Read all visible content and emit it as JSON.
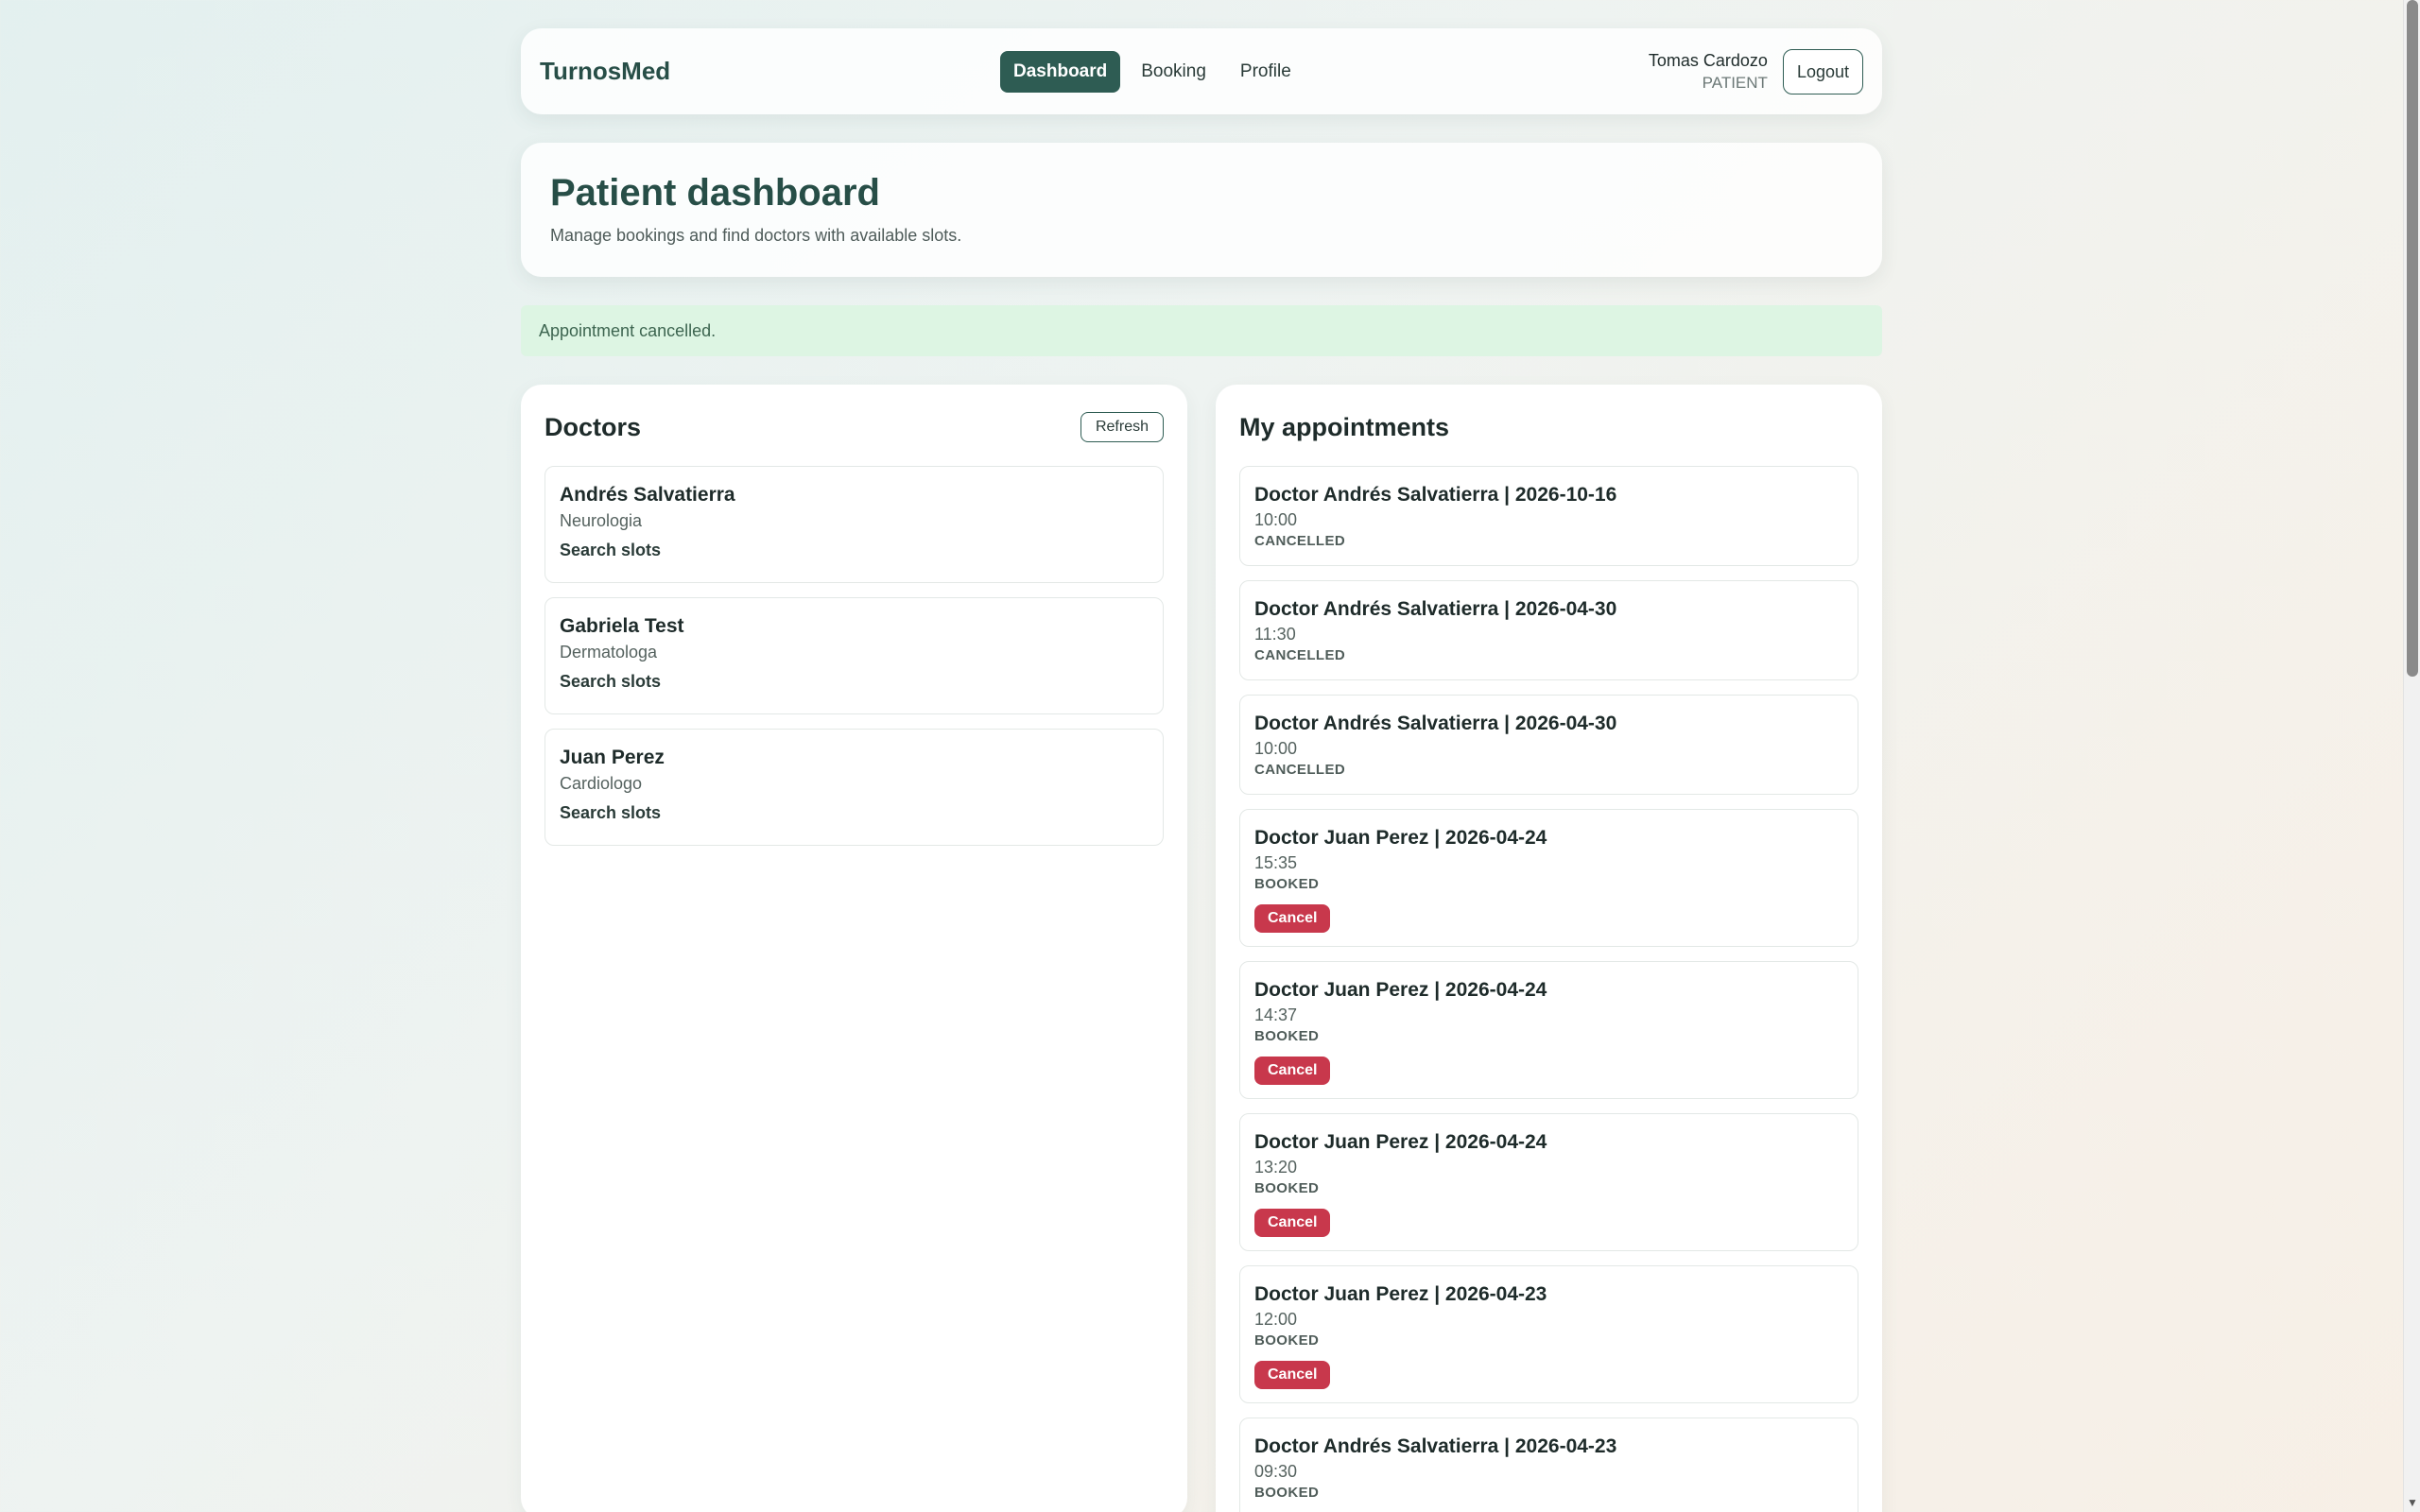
{
  "brand": "TurnosMed",
  "nav": [
    {
      "label": "Dashboard",
      "active": true
    },
    {
      "label": "Booking",
      "active": false
    },
    {
      "label": "Profile",
      "active": false
    }
  ],
  "user": {
    "name": "Tomas Cardozo",
    "role": "PATIENT",
    "logout_label": "Logout"
  },
  "hero": {
    "title": "Patient dashboard",
    "subtitle": "Manage bookings and find doctors with available slots."
  },
  "alert": {
    "message": "Appointment cancelled."
  },
  "doctors": {
    "title": "Doctors",
    "refresh_label": "Refresh",
    "items": [
      {
        "name": "Andrés Salvatierra",
        "specialty": "Neurologia",
        "action": "Search slots"
      },
      {
        "name": "Gabriela Test",
        "specialty": "Dermatologa",
        "action": "Search slots"
      },
      {
        "name": "Juan Perez",
        "specialty": "Cardiologo",
        "action": "Search slots"
      }
    ]
  },
  "appointments": {
    "title": "My appointments",
    "cancel_label": "Cancel",
    "items": [
      {
        "title": "Doctor Andrés Salvatierra | 2026-10-16",
        "time": "10:00",
        "status": "CANCELLED"
      },
      {
        "title": "Doctor Andrés Salvatierra | 2026-04-30",
        "time": "11:30",
        "status": "CANCELLED"
      },
      {
        "title": "Doctor Andrés Salvatierra | 2026-04-30",
        "time": "10:00",
        "status": "CANCELLED"
      },
      {
        "title": "Doctor Juan Perez | 2026-04-24",
        "time": "15:35",
        "status": "BOOKED"
      },
      {
        "title": "Doctor Juan Perez | 2026-04-24",
        "time": "14:37",
        "status": "BOOKED"
      },
      {
        "title": "Doctor Juan Perez | 2026-04-24",
        "time": "13:20",
        "status": "BOOKED"
      },
      {
        "title": "Doctor Juan Perez | 2026-04-23",
        "time": "12:00",
        "status": "BOOKED"
      },
      {
        "title": "Doctor Andrés Salvatierra | 2026-04-23",
        "time": "09:30",
        "status": "BOOKED"
      }
    ]
  },
  "colors": {
    "accent": "#2e5c53",
    "danger": "#c8384c",
    "alert_bg": "#ddf5e3"
  }
}
